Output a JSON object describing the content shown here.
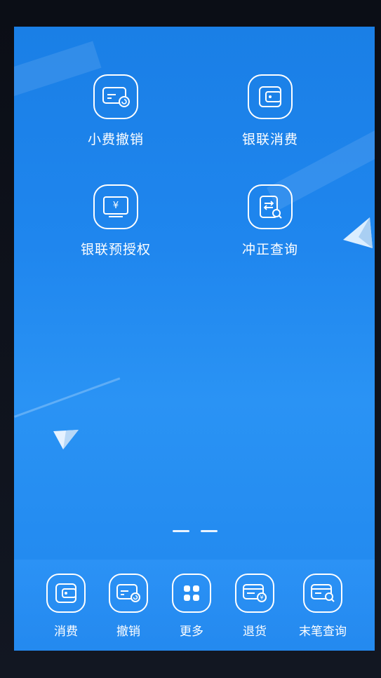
{
  "home": {
    "apps": [
      {
        "label": "小费撤销",
        "icon": "card-undo-icon"
      },
      {
        "label": "银联消费",
        "icon": "wallet-icon"
      },
      {
        "label": "银联预授权",
        "icon": "yuan-screen-icon"
      },
      {
        "label": "冲正查询",
        "icon": "reversal-search-icon"
      }
    ],
    "pager": {
      "pages": 2,
      "current": 1
    }
  },
  "dock": {
    "items": [
      {
        "label": "消费",
        "icon": "wallet-icon"
      },
      {
        "label": "撤销",
        "icon": "card-undo-icon"
      },
      {
        "label": "更多",
        "icon": "grid-more-icon"
      },
      {
        "label": "退货",
        "icon": "card-refund-icon"
      },
      {
        "label": "末笔查询",
        "icon": "card-search-icon"
      }
    ]
  },
  "colors": {
    "screen_bg": "#1f86ee",
    "icon_stroke": "#ffffff",
    "bezel": "#0b0e16"
  }
}
